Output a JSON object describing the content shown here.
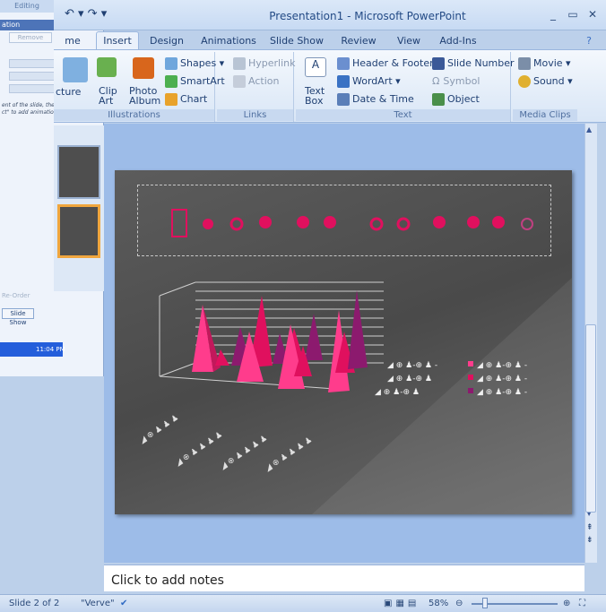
{
  "window": {
    "title": "Presentation1 - Microsoft PowerPoint",
    "qat_items": [
      "undo-arrow",
      "redo-arrow",
      "customize-dropdown"
    ]
  },
  "tabs": [
    {
      "label": "me",
      "active": false
    },
    {
      "label": "Insert",
      "active": true
    },
    {
      "label": "Design",
      "active": false
    },
    {
      "label": "Animations",
      "active": false
    },
    {
      "label": "Slide Show",
      "active": false
    },
    {
      "label": "Review",
      "active": false
    },
    {
      "label": "View",
      "active": false
    },
    {
      "label": "Add-Ins",
      "active": false
    }
  ],
  "ribbon": {
    "illustrations": {
      "label": "Illustrations",
      "picture": "cture",
      "clip_art": "Clip Art",
      "photo_album": "Photo Album",
      "shapes": "Shapes",
      "smartart": "SmartArt",
      "chart": "Chart"
    },
    "links": {
      "label": "Links",
      "hyperlink": "Hyperlink",
      "action": "Action"
    },
    "text": {
      "label": "Text",
      "text_box": "Text Box",
      "header_footer": "Header & Footer",
      "wordart": "WordArt",
      "date_time": "Date & Time",
      "slide_number": "Slide Number",
      "symbol": "Symbol",
      "object": "Object"
    },
    "media": {
      "label": "Media Clips",
      "movie": "Movie",
      "sound": "Sound"
    }
  },
  "left_panel": {
    "editing_label": "Editing",
    "pane_title": "ation",
    "remove_label": "Remove",
    "hint": "ent of the slide, then ct\" to add animation.",
    "reorder_label": "Re-Order",
    "slide_show_label": "Slide Show",
    "tray_time": "11:04 PM"
  },
  "notes": {
    "placeholder": "Click to add notes"
  },
  "status": {
    "slide_info": "Slide 2 of 2",
    "theme": "\"Verve\"",
    "zoom": "58%"
  },
  "colors": {
    "pink": "#ff3c8c",
    "magenta": "#e0105e",
    "purple": "#8c1a6e"
  }
}
